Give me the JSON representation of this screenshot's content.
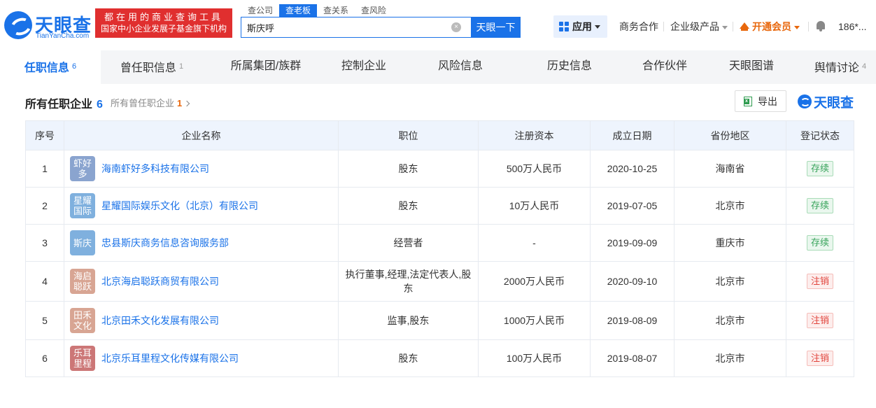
{
  "header": {
    "logo_cn": "天眼查",
    "logo_en": "TianYanCha.com",
    "slogan_line1": "都在用的商业查询工具",
    "slogan_line2": "国家中小企业发展子基金旗下机构",
    "search_tabs": [
      {
        "label": "查公司",
        "active": false
      },
      {
        "label": "查老板",
        "active": true
      },
      {
        "label": "查关系",
        "active": false
      },
      {
        "label": "查风险",
        "active": false
      }
    ],
    "search_value": "斯庆呼",
    "search_button": "天眼一下",
    "apps_label": "应用",
    "nav_business": "商务合作",
    "nav_enterprise": "企业级产品",
    "nav_vip": "开通会员",
    "nav_user": "186*..."
  },
  "tabs": [
    {
      "label": "任职信息",
      "count": "6",
      "active": true
    },
    {
      "label": "曾任职信息",
      "count": "1",
      "active": false
    },
    {
      "label": "所属集团/族群",
      "count": "",
      "active": false
    },
    {
      "label": "控制企业",
      "count": "",
      "active": false
    },
    {
      "label": "风险信息",
      "count": "",
      "active": false
    },
    {
      "label": "历史信息",
      "count": "",
      "active": false
    },
    {
      "label": "合作伙伴",
      "count": "",
      "active": false
    },
    {
      "label": "天眼图谱",
      "count": "",
      "active": false
    },
    {
      "label": "舆情讨论",
      "count": "4",
      "active": false
    }
  ],
  "section": {
    "title": "所有任职企业",
    "title_count": "6",
    "sub_label": "所有曾任职企业",
    "sub_count": "1",
    "export_label": "导出",
    "brand": "天眼查"
  },
  "table": {
    "headers": [
      "序号",
      "企业名称",
      "职位",
      "注册资本",
      "成立日期",
      "省份地区",
      "登记状态"
    ],
    "rows": [
      {
        "no": "1",
        "avatar": "虾好多",
        "avatar_color": "#8aa4cf",
        "name": "海南虾好多科技有限公司",
        "position": "股东",
        "capital": "500万人民币",
        "date": "2020-10-25",
        "region": "海南省",
        "status": "存续",
        "status_type": "ok"
      },
      {
        "no": "2",
        "avatar": "星耀国际",
        "avatar_color": "#7fb0de",
        "name": "星耀国际娱乐文化（北京）有限公司",
        "position": "股东",
        "capital": "10万人民币",
        "date": "2019-07-05",
        "region": "北京市",
        "status": "存续",
        "status_type": "ok"
      },
      {
        "no": "3",
        "avatar": "斯庆",
        "avatar_color": "#7fb0de",
        "name": "忠县斯庆商务信息咨询服务部",
        "position": "经营者",
        "capital": "-",
        "date": "2019-09-09",
        "region": "重庆市",
        "status": "存续",
        "status_type": "ok"
      },
      {
        "no": "4",
        "avatar": "海启聪跃",
        "avatar_color": "#d8a593",
        "name": "北京海启聪跃商贸有限公司",
        "position": "执行董事,经理,法定代表人,股东",
        "capital": "2000万人民币",
        "date": "2020-09-10",
        "region": "北京市",
        "status": "注销",
        "status_type": "off"
      },
      {
        "no": "5",
        "avatar": "田禾文化",
        "avatar_color": "#d8a593",
        "name": "北京田禾文化发展有限公司",
        "position": "监事,股东",
        "capital": "1000万人民币",
        "date": "2019-08-09",
        "region": "北京市",
        "status": "注销",
        "status_type": "off"
      },
      {
        "no": "6",
        "avatar": "乐耳里程",
        "avatar_color": "#cc7777",
        "name": "北京乐耳里程文化传媒有限公司",
        "position": "股东",
        "capital": "100万人民币",
        "date": "2019-08-07",
        "region": "北京市",
        "status": "注销",
        "status_type": "off"
      }
    ]
  }
}
